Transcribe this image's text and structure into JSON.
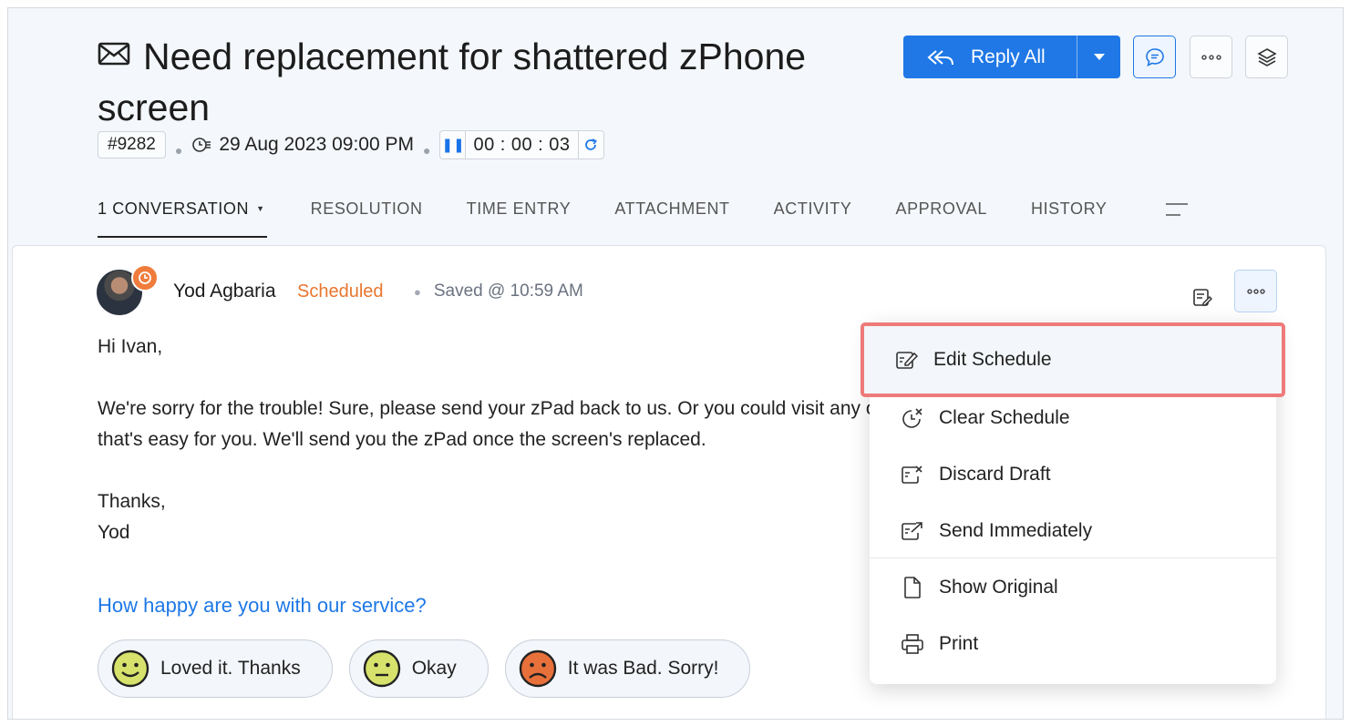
{
  "ticket": {
    "title": "Need replacement for shattered zPhone screen",
    "id": "#9282",
    "due_date": "29 Aug 2023 09:00 PM",
    "timer": "00 : 00 : 03"
  },
  "toolbar": {
    "reply_label": "Reply All",
    "icons": [
      "reply-all-icon",
      "caret-down-icon",
      "comment-icon",
      "more-icon",
      "layers-icon"
    ]
  },
  "tabs": [
    {
      "label": "1 CONVERSATION",
      "active": true
    },
    {
      "label": "RESOLUTION"
    },
    {
      "label": "TIME ENTRY"
    },
    {
      "label": "ATTACHMENT"
    },
    {
      "label": "ACTIVITY"
    },
    {
      "label": "APPROVAL"
    },
    {
      "label": "HISTORY"
    }
  ],
  "thread": {
    "author": "Yod Agbaria",
    "status": "Scheduled",
    "status_color": "#e8762e",
    "saved": "Saved @ 10:59 AM",
    "body": [
      "Hi Ivan,",
      "We're sorry for the trouble! Sure, please send your zPad back to us. Or you could visit any of our stores",
      "that's easy for you. We'll send you the zPad once the screen's replaced.",
      "Thanks,",
      "Yod"
    ]
  },
  "survey": {
    "question": "How happy are you with our service?",
    "options": [
      {
        "label": "Loved it. Thanks",
        "color": "#d6e26b"
      },
      {
        "label": "Okay",
        "color": "#d6e26b"
      },
      {
        "label": "It was Bad. Sorry!",
        "color": "#e8703a"
      }
    ]
  },
  "menu": {
    "items": [
      {
        "label": "Edit Schedule",
        "icon": "edit-schedule-icon",
        "highlighted": true
      },
      {
        "label": "Clear Schedule",
        "icon": "clear-schedule-icon"
      },
      {
        "label": "Discard Draft",
        "icon": "discard-draft-icon"
      },
      {
        "label": "Send Immediately",
        "icon": "send-immediately-icon"
      },
      {
        "label": "Show Original",
        "icon": "document-icon"
      },
      {
        "label": "Print",
        "icon": "printer-icon"
      }
    ]
  },
  "colors": {
    "accent": "#1f78e6",
    "highlight_border": "#ee7a7a"
  }
}
